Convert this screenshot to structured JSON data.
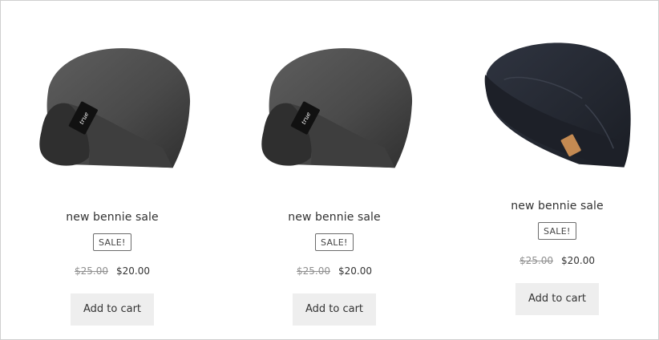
{
  "products": [
    {
      "title": "new bennie sale",
      "badge": "SALE!",
      "price_old": "$25.00",
      "price_new": "$20.00",
      "button_label": "Add to cart",
      "image_icon": "gray-beanie-image",
      "label_text": "true"
    },
    {
      "title": "new bennie sale",
      "badge": "SALE!",
      "price_old": "$25.00",
      "price_new": "$20.00",
      "button_label": "Add to cart",
      "image_icon": "gray-beanie-image",
      "label_text": "true"
    },
    {
      "title": "new bennie sale",
      "badge": "SALE!",
      "price_old": "$25.00",
      "price_new": "$20.00",
      "button_label": "Add to cart",
      "image_icon": "navy-beanie-image"
    }
  ],
  "colors": {
    "button_bg": "#eeeeee",
    "badge_border": "#6b6b6b",
    "old_price": "#8f8f8f",
    "text": "#333333"
  }
}
